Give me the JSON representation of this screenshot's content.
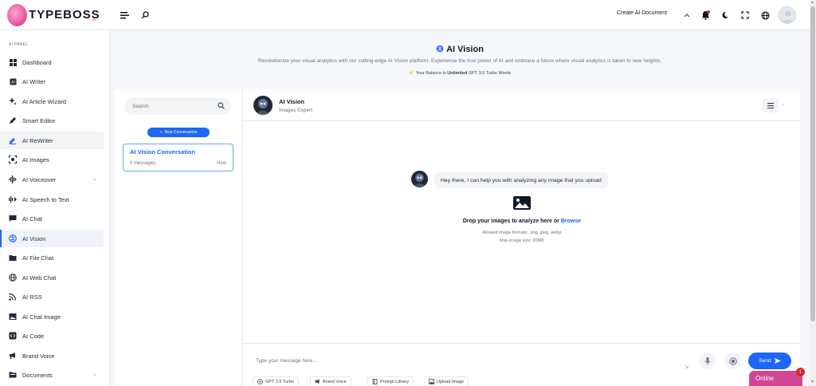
{
  "brand": {
    "name": "TYPEBOSS",
    "tagline": "AI"
  },
  "topbar": {
    "create_doc": "Create AI Document"
  },
  "sidebar": {
    "panel_title": "AI PANEL",
    "items": [
      {
        "label": "Dashboard",
        "icon": "dashboard-icon"
      },
      {
        "label": "AI Writer",
        "icon": "ai-writer-icon"
      },
      {
        "label": "AI Article Wizard",
        "icon": "sparkles-icon"
      },
      {
        "label": "Smart Editor",
        "icon": "pen-icon"
      },
      {
        "label": "AI ReWriter",
        "icon": "edit-icon"
      },
      {
        "label": "AI Images",
        "icon": "image-scan-icon"
      },
      {
        "label": "AI Voiceover",
        "icon": "waveform-icon"
      },
      {
        "label": "AI Speech to Text",
        "icon": "voice-icon"
      },
      {
        "label": "AI Chat",
        "icon": "chat-icon"
      },
      {
        "label": "AI Vision",
        "icon": "brain-icon"
      },
      {
        "label": "AI File Chat",
        "icon": "folder-icon"
      },
      {
        "label": "AI Web Chat",
        "icon": "globe-icon"
      },
      {
        "label": "AI RSS",
        "icon": "rss-icon"
      },
      {
        "label": "AI Chat Image",
        "icon": "chat-image-icon"
      },
      {
        "label": "AI Code",
        "icon": "code-icon"
      },
      {
        "label": "Brand Voice",
        "icon": "megaphone-icon"
      },
      {
        "label": "Documents",
        "icon": "documents-icon"
      }
    ]
  },
  "hero": {
    "title": "AI Vision",
    "description": "Revolutionize your visual analytics with our cutting-edge AI Vision platform. Experience the true power of AI and embrace a future where visual analytics is taken to new heights.",
    "balance_prefix": "Your Balance is",
    "balance_value": "Unlimited",
    "balance_suffix": "GPT 3.5 Turbo Words"
  },
  "conversations": {
    "search_placeholder": "Search",
    "new_button": "New Conversation",
    "items": [
      {
        "title": "AI Vision Conversation",
        "count": "0 messages",
        "time": "Now"
      }
    ]
  },
  "chat": {
    "bot_name": "AI Vision",
    "bot_role": "Images Expert",
    "greeting": "Hey there, I can help you with analyzing any image that you upload",
    "drop_text": "Drop your images to analyze here or",
    "drop_link": "Browse",
    "formats": "Allowed image formats: .png .jpeg .webp",
    "max_size": "Max image size: 20MB",
    "input_placeholder": "Type your message here...",
    "send_label": "Send",
    "chips": [
      "GPT 3.5 Turbo",
      "Brand Voice",
      "Prompt Library",
      "Upload Image"
    ]
  },
  "online": {
    "label": "Online",
    "badge": "1"
  },
  "colors": {
    "accent": "#1e66f5",
    "online": "#d14796",
    "badge": "#dc2626"
  }
}
